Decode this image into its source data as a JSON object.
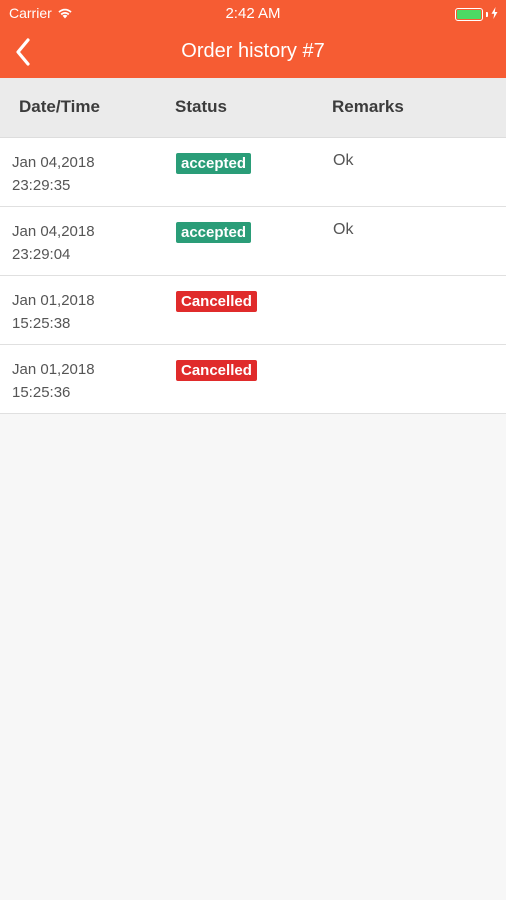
{
  "status_bar": {
    "carrier": "Carrier",
    "time": "2:42 AM",
    "battery_level": 1.0,
    "charging": true
  },
  "nav": {
    "title": "Order history #7",
    "back_icon": "chevron-left-icon"
  },
  "colors": {
    "header_bg": "#f65c33",
    "accepted": "#2a9d78",
    "cancelled": "#e02b2b"
  },
  "table": {
    "columns": [
      "Date/Time",
      "Status",
      "Remarks"
    ],
    "rows": [
      {
        "date": "Jan 04,2018",
        "time": "23:29:35",
        "status": "accepted",
        "status_type": "accepted",
        "remarks": "Ok"
      },
      {
        "date": "Jan 04,2018",
        "time": "23:29:04",
        "status": "accepted",
        "status_type": "accepted",
        "remarks": "Ok"
      },
      {
        "date": "Jan 01,2018",
        "time": "15:25:38",
        "status": "Cancelled",
        "status_type": "cancelled",
        "remarks": ""
      },
      {
        "date": "Jan 01,2018",
        "time": "15:25:36",
        "status": "Cancelled",
        "status_type": "cancelled",
        "remarks": ""
      }
    ]
  }
}
